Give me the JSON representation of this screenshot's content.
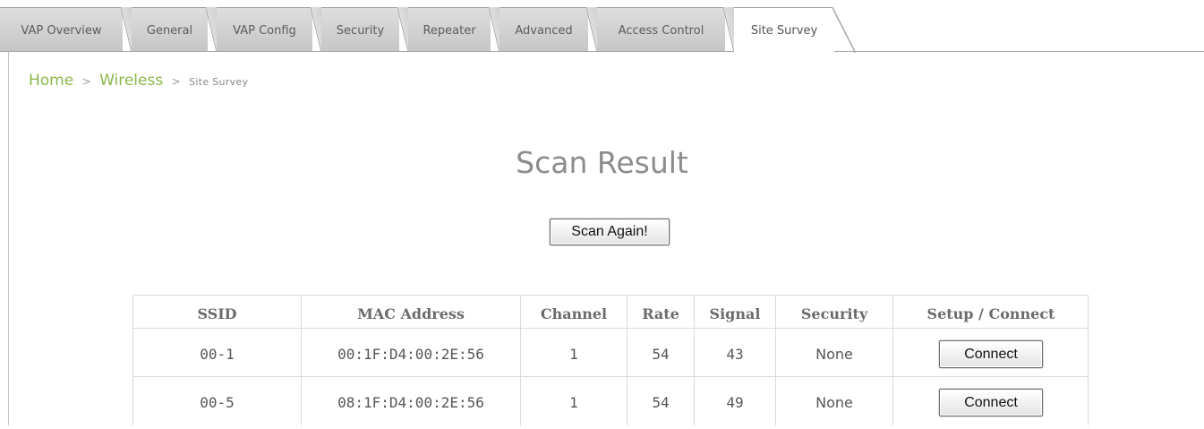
{
  "tabs": [
    {
      "label": "VAP Overview"
    },
    {
      "label": "General"
    },
    {
      "label": "VAP Config"
    },
    {
      "label": "Security"
    },
    {
      "label": "Repeater"
    },
    {
      "label": "Advanced"
    },
    {
      "label": "Access Control"
    },
    {
      "label": "Site Survey",
      "active": true
    }
  ],
  "breadcrumb": {
    "home": "Home",
    "sep1": ">",
    "section": "Wireless",
    "sep2": ">",
    "current": "Site Survey"
  },
  "page_title": "Scan Result",
  "scan_button_label": "Scan Again!",
  "table": {
    "columns": [
      "SSID",
      "MAC Address",
      "Channel",
      "Rate",
      "Signal",
      "Security",
      "Setup / Connect"
    ],
    "rows": [
      {
        "ssid": "00-1",
        "mac": "00:1F:D4:00:2E:56",
        "channel": "1",
        "rate": "54",
        "signal": "43",
        "security": "None",
        "action": "Connect"
      },
      {
        "ssid": "00-5",
        "mac": "08:1F:D4:00:2E:56",
        "channel": "1",
        "rate": "54",
        "signal": "49",
        "security": "None",
        "action": "Connect"
      }
    ]
  },
  "colors": {
    "breadcrumb_link": "#8ab84a",
    "title": "#8c8c8c",
    "tab_inactive": "#cfcfcf",
    "table_border": "#d9d9d9"
  }
}
